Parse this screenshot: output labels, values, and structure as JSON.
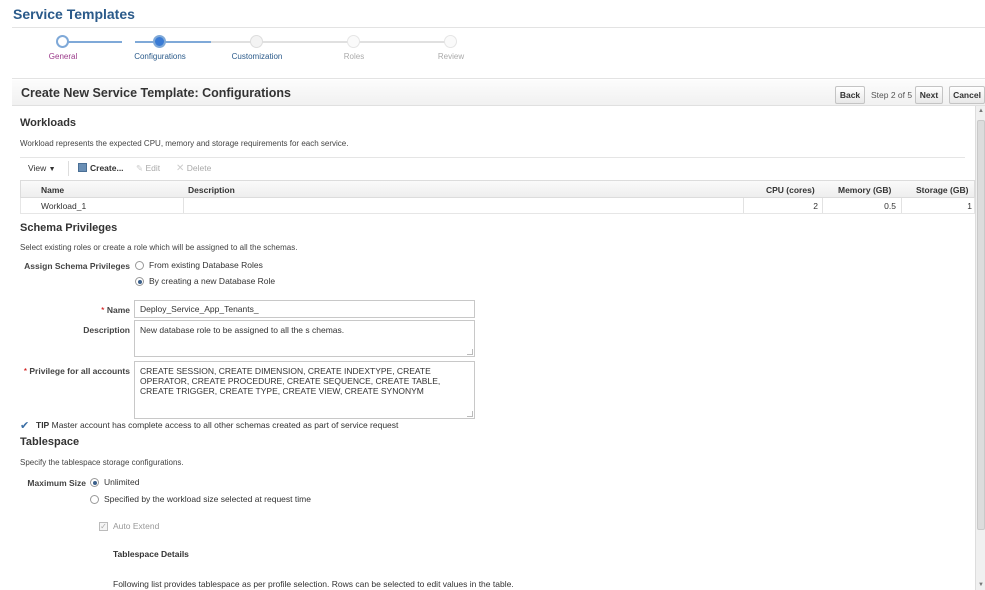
{
  "page": {
    "title": "Service Templates"
  },
  "train": {
    "steps": [
      {
        "label": "General",
        "state": "visited"
      },
      {
        "label": "Configurations",
        "state": "current"
      },
      {
        "label": "Customization",
        "state": "next"
      },
      {
        "label": "Roles",
        "state": "disabled"
      },
      {
        "label": "Review",
        "state": "disabled"
      }
    ]
  },
  "header": {
    "title": "Create New Service Template: Configurations",
    "back_label": "Back",
    "step_text": "Step 2 of 5",
    "next_label": "Next",
    "cancel_label": "Cancel"
  },
  "workloads": {
    "heading": "Workloads",
    "description": "Workload represents the expected CPU, memory and storage requirements for each service.",
    "toolbar": {
      "view_label": "View",
      "create_label": "Create...",
      "edit_label": "Edit",
      "delete_label": "Delete"
    },
    "columns": [
      "Name",
      "Description",
      "CPU (cores)",
      "Memory (GB)",
      "Storage (GB)"
    ],
    "rows": [
      {
        "name": "Workload_1",
        "description": "",
        "cpu": "2",
        "memory": "0.5",
        "storage": "1"
      }
    ]
  },
  "schema": {
    "heading": "Schema Privileges",
    "description": "Select existing roles or create a role which will be assigned to all the schemas.",
    "assign_label": "Assign Schema Privileges",
    "option_existing": "From existing Database Roles",
    "option_new": "By creating a new Database Role",
    "name_label": "Name",
    "name_value": "Deploy_Service_App_Tenants_",
    "description_label": "Description",
    "description_value": "New database role to be assigned to all the s chemas.",
    "privilege_label": "Privilege for all accounts",
    "privilege_value": "CREATE SESSION, CREATE DIMENSION, CREATE INDEXTYPE, CREATE OPERATOR, CREATE PROCEDURE, CREATE SEQUENCE, CREATE TABLE, CREATE TRIGGER, CREATE TYPE, CREATE VIEW, CREATE SYNONYM",
    "tip_label": "TIP",
    "tip_text": "Master account has complete access to all other schemas created as part of service request"
  },
  "tablespace": {
    "heading": "Tablespace",
    "description": "Specify the tablespace storage configurations.",
    "max_size_label": "Maximum Size",
    "option_unlimited": "Unlimited",
    "option_specified": "Specified by the workload size selected at request time",
    "auto_extend_label": "Auto Extend",
    "details_heading": "Tablespace Details",
    "details_text": "Following list provides tablespace as per profile selection. Rows can be selected to edit values in the table."
  },
  "colors": {
    "title_blue": "#2a5a8a",
    "train_active": "#3a7bd5",
    "train_visited": "#9b3a8a",
    "required": "#cc0000"
  }
}
